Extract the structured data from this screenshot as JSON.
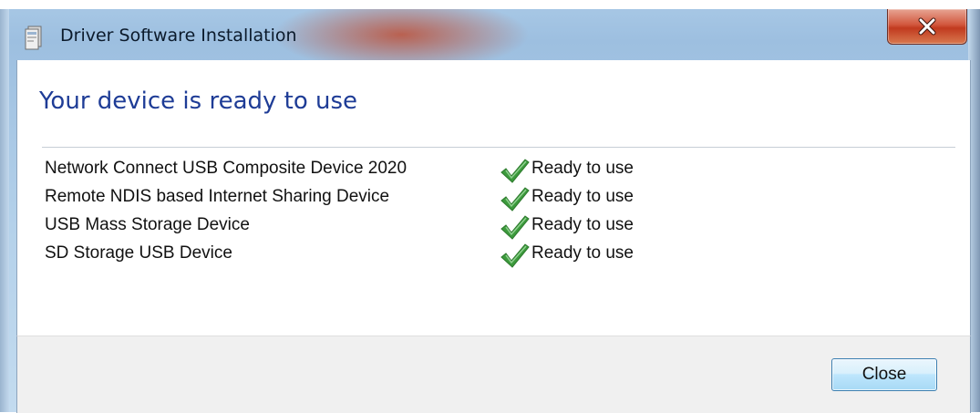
{
  "window": {
    "title": "Driver Software Installation",
    "app_icon": "driver-installer-icon",
    "close_icon": "close-x-icon"
  },
  "main": {
    "heading": "Your device is ready to use",
    "devices": [
      {
        "name": "Network Connect USB Composite Device 2020",
        "status": "Ready to use",
        "status_icon": "green-check-icon"
      },
      {
        "name": "Remote NDIS based Internet Sharing Device",
        "status": "Ready to use",
        "status_icon": "green-check-icon"
      },
      {
        "name": "USB Mass Storage Device",
        "status": "Ready to use",
        "status_icon": "green-check-icon"
      },
      {
        "name": "SD Storage USB Device",
        "status": "Ready to use",
        "status_icon": "green-check-icon"
      }
    ]
  },
  "footer": {
    "close_label": "Close"
  },
  "colors": {
    "heading": "#1e3c96",
    "check": "#3c9a3c",
    "close_button_border": "#3c7fb1",
    "caption_close": "#c13a1f"
  }
}
